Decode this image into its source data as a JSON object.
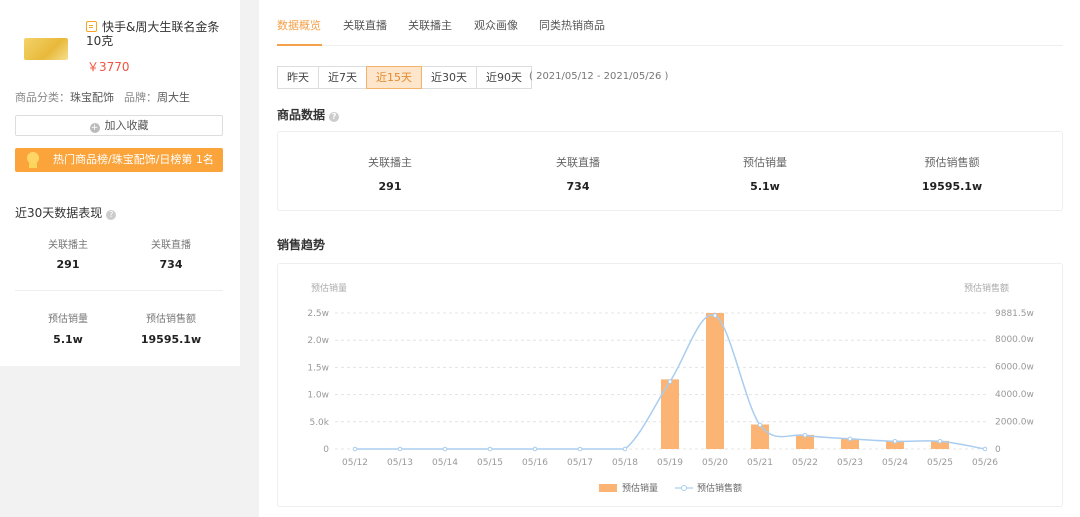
{
  "product": {
    "title": "快手&周大生联名金条 10克",
    "price": "￥3770",
    "category_label": "商品分类：",
    "category": "珠宝配饰",
    "brand_label": "品牌：",
    "brand": "周大生",
    "favorite_button": "加入收藏",
    "favorite_icon": "plus-icon",
    "rank_badge": "热门商品榜/珠宝配饰/日榜第 1名"
  },
  "last30": {
    "title": "近30天数据表现",
    "stats": [
      {
        "label": "关联播主",
        "value": "291"
      },
      {
        "label": "关联直播",
        "value": "734"
      },
      {
        "label": "预估销量",
        "value": "5.1w"
      },
      {
        "label": "预估销售额",
        "value": "19595.1w"
      }
    ]
  },
  "tabs": [
    {
      "label": "数据概览",
      "active": true
    },
    {
      "label": "关联直播",
      "active": false
    },
    {
      "label": "关联播主",
      "active": false
    },
    {
      "label": "观众画像",
      "active": false
    },
    {
      "label": "同类热销商品",
      "active": false
    }
  ],
  "ranges": [
    {
      "label": "昨天",
      "active": false
    },
    {
      "label": "近7天",
      "active": false
    },
    {
      "label": "近15天",
      "active": true
    },
    {
      "label": "近30天",
      "active": false
    },
    {
      "label": "近90天",
      "active": false
    }
  ],
  "date_range": "( 2021/05/12 - 2021/05/26 )",
  "product_data": {
    "title": "商品数据",
    "stats": [
      {
        "label": "关联播主",
        "value": "291"
      },
      {
        "label": "关联直播",
        "value": "734"
      },
      {
        "label": "预估销量",
        "value": "5.1w"
      },
      {
        "label": "预估销售额",
        "value": "19595.1w"
      }
    ]
  },
  "sales_trend": {
    "title": "销售趋势"
  },
  "colors": {
    "accent": "#f5a04a",
    "bar": "#fbb474",
    "line": "#a9cdf0",
    "price": "#f0533f"
  },
  "chart_data": {
    "type": "bar",
    "categories": [
      "05/12",
      "05/13",
      "05/14",
      "05/15",
      "05/16",
      "05/17",
      "05/18",
      "05/19",
      "05/20",
      "05/21",
      "05/22",
      "05/23",
      "05/24",
      "05/25",
      "05/26"
    ],
    "ylabel": "预估销量",
    "y2label": "预估销售额",
    "ylim": [
      0,
      25000
    ],
    "y2lim": [
      0,
      9881.5
    ],
    "yticks": [
      "0",
      "5.0k",
      "1.0w",
      "1.5w",
      "2.0w",
      "2.5w"
    ],
    "y2ticks": [
      "0",
      "2000.0w",
      "4000.0w",
      "6000.0w",
      "8000.0w",
      "9881.5w"
    ],
    "series": [
      {
        "name": "预估销量",
        "type": "bar",
        "values": [
          0,
          0,
          0,
          0,
          0,
          0,
          0,
          12800,
          25000,
          4500,
          2600,
          1900,
          1500,
          1500,
          0
        ]
      },
      {
        "name": "预估销售额",
        "type": "line",
        "values": [
          0,
          0,
          0,
          0,
          0,
          0,
          0,
          4900,
          9700,
          1750,
          1000,
          740,
          560,
          560,
          0
        ]
      }
    ],
    "legend_position": "bottom",
    "grid": true
  }
}
